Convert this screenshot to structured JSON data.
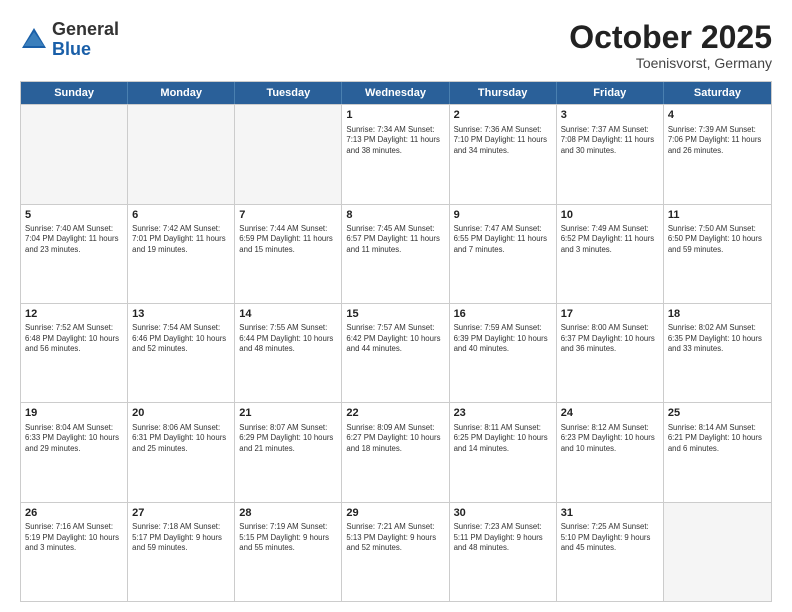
{
  "header": {
    "logo_general": "General",
    "logo_blue": "Blue",
    "month_title": "October 2025",
    "location": "Toenisvorst, Germany"
  },
  "calendar": {
    "days": [
      "Sunday",
      "Monday",
      "Tuesday",
      "Wednesday",
      "Thursday",
      "Friday",
      "Saturday"
    ],
    "rows": [
      [
        {
          "day": "",
          "empty": true
        },
        {
          "day": "",
          "empty": true
        },
        {
          "day": "",
          "empty": true
        },
        {
          "day": "1",
          "info": "Sunrise: 7:34 AM\nSunset: 7:13 PM\nDaylight: 11 hours\nand 38 minutes."
        },
        {
          "day": "2",
          "info": "Sunrise: 7:36 AM\nSunset: 7:10 PM\nDaylight: 11 hours\nand 34 minutes."
        },
        {
          "day": "3",
          "info": "Sunrise: 7:37 AM\nSunset: 7:08 PM\nDaylight: 11 hours\nand 30 minutes."
        },
        {
          "day": "4",
          "info": "Sunrise: 7:39 AM\nSunset: 7:06 PM\nDaylight: 11 hours\nand 26 minutes."
        }
      ],
      [
        {
          "day": "5",
          "info": "Sunrise: 7:40 AM\nSunset: 7:04 PM\nDaylight: 11 hours\nand 23 minutes."
        },
        {
          "day": "6",
          "info": "Sunrise: 7:42 AM\nSunset: 7:01 PM\nDaylight: 11 hours\nand 19 minutes."
        },
        {
          "day": "7",
          "info": "Sunrise: 7:44 AM\nSunset: 6:59 PM\nDaylight: 11 hours\nand 15 minutes."
        },
        {
          "day": "8",
          "info": "Sunrise: 7:45 AM\nSunset: 6:57 PM\nDaylight: 11 hours\nand 11 minutes."
        },
        {
          "day": "9",
          "info": "Sunrise: 7:47 AM\nSunset: 6:55 PM\nDaylight: 11 hours\nand 7 minutes."
        },
        {
          "day": "10",
          "info": "Sunrise: 7:49 AM\nSunset: 6:52 PM\nDaylight: 11 hours\nand 3 minutes."
        },
        {
          "day": "11",
          "info": "Sunrise: 7:50 AM\nSunset: 6:50 PM\nDaylight: 10 hours\nand 59 minutes."
        }
      ],
      [
        {
          "day": "12",
          "info": "Sunrise: 7:52 AM\nSunset: 6:48 PM\nDaylight: 10 hours\nand 56 minutes."
        },
        {
          "day": "13",
          "info": "Sunrise: 7:54 AM\nSunset: 6:46 PM\nDaylight: 10 hours\nand 52 minutes."
        },
        {
          "day": "14",
          "info": "Sunrise: 7:55 AM\nSunset: 6:44 PM\nDaylight: 10 hours\nand 48 minutes."
        },
        {
          "day": "15",
          "info": "Sunrise: 7:57 AM\nSunset: 6:42 PM\nDaylight: 10 hours\nand 44 minutes."
        },
        {
          "day": "16",
          "info": "Sunrise: 7:59 AM\nSunset: 6:39 PM\nDaylight: 10 hours\nand 40 minutes."
        },
        {
          "day": "17",
          "info": "Sunrise: 8:00 AM\nSunset: 6:37 PM\nDaylight: 10 hours\nand 36 minutes."
        },
        {
          "day": "18",
          "info": "Sunrise: 8:02 AM\nSunset: 6:35 PM\nDaylight: 10 hours\nand 33 minutes."
        }
      ],
      [
        {
          "day": "19",
          "info": "Sunrise: 8:04 AM\nSunset: 6:33 PM\nDaylight: 10 hours\nand 29 minutes."
        },
        {
          "day": "20",
          "info": "Sunrise: 8:06 AM\nSunset: 6:31 PM\nDaylight: 10 hours\nand 25 minutes."
        },
        {
          "day": "21",
          "info": "Sunrise: 8:07 AM\nSunset: 6:29 PM\nDaylight: 10 hours\nand 21 minutes."
        },
        {
          "day": "22",
          "info": "Sunrise: 8:09 AM\nSunset: 6:27 PM\nDaylight: 10 hours\nand 18 minutes."
        },
        {
          "day": "23",
          "info": "Sunrise: 8:11 AM\nSunset: 6:25 PM\nDaylight: 10 hours\nand 14 minutes."
        },
        {
          "day": "24",
          "info": "Sunrise: 8:12 AM\nSunset: 6:23 PM\nDaylight: 10 hours\nand 10 minutes."
        },
        {
          "day": "25",
          "info": "Sunrise: 8:14 AM\nSunset: 6:21 PM\nDaylight: 10 hours\nand 6 minutes."
        }
      ],
      [
        {
          "day": "26",
          "info": "Sunrise: 7:16 AM\nSunset: 5:19 PM\nDaylight: 10 hours\nand 3 minutes."
        },
        {
          "day": "27",
          "info": "Sunrise: 7:18 AM\nSunset: 5:17 PM\nDaylight: 9 hours\nand 59 minutes."
        },
        {
          "day": "28",
          "info": "Sunrise: 7:19 AM\nSunset: 5:15 PM\nDaylight: 9 hours\nand 55 minutes."
        },
        {
          "day": "29",
          "info": "Sunrise: 7:21 AM\nSunset: 5:13 PM\nDaylight: 9 hours\nand 52 minutes."
        },
        {
          "day": "30",
          "info": "Sunrise: 7:23 AM\nSunset: 5:11 PM\nDaylight: 9 hours\nand 48 minutes."
        },
        {
          "day": "31",
          "info": "Sunrise: 7:25 AM\nSunset: 5:10 PM\nDaylight: 9 hours\nand 45 minutes."
        },
        {
          "day": "",
          "empty": true
        }
      ]
    ]
  }
}
